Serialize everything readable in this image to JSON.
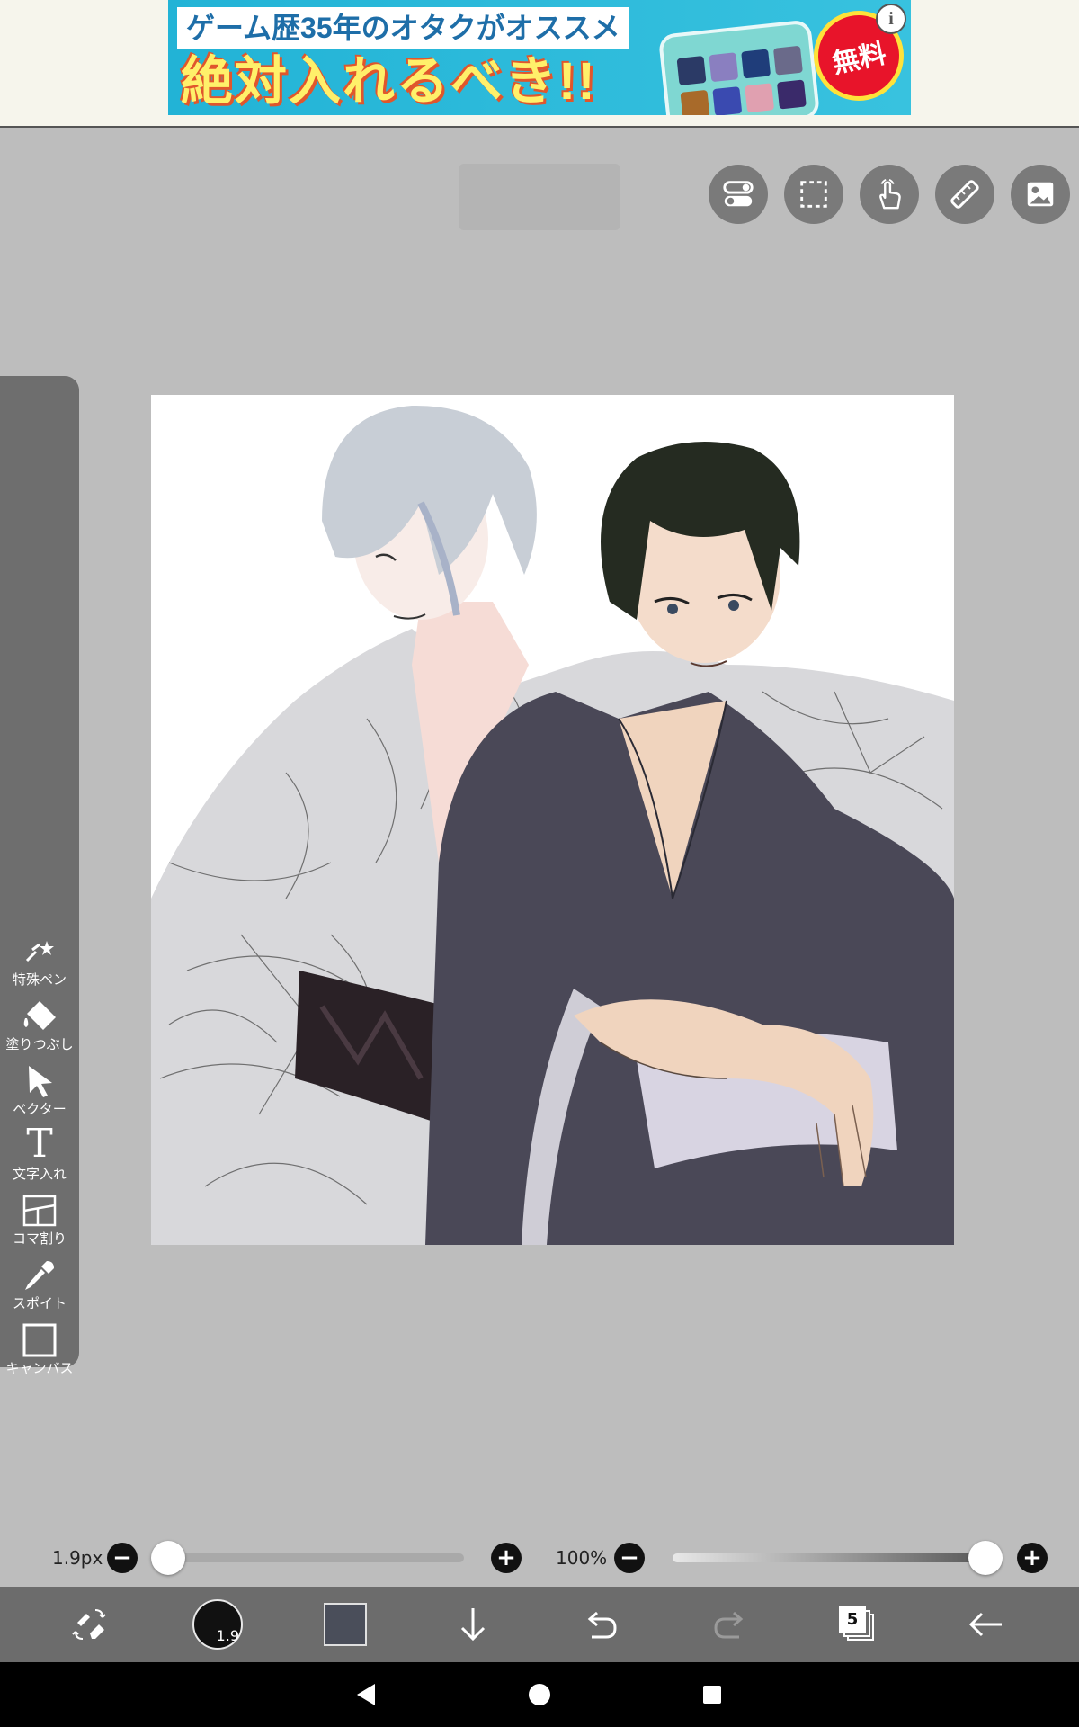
{
  "ad": {
    "line1": "ゲーム歴35年のオタクがオススメ",
    "line2": "絶対入れるべき!!",
    "badge": "無料",
    "info_icon": "info-icon"
  },
  "top_toolbar": {
    "buttons": [
      {
        "name": "toggle-icon"
      },
      {
        "name": "selection-icon"
      },
      {
        "name": "hand-icon"
      },
      {
        "name": "ruler-icon"
      },
      {
        "name": "image-icon"
      }
    ]
  },
  "left_toolbar": {
    "tools": [
      {
        "label": "特殊ペン",
        "icon": "special-pen-icon"
      },
      {
        "label": "塗りつぶし",
        "icon": "fill-icon"
      },
      {
        "label": "ベクター",
        "icon": "vector-icon"
      },
      {
        "label": "文字入れ",
        "icon": "text-icon",
        "glyph": "T"
      },
      {
        "label": "コマ割り",
        "icon": "panel-icon"
      },
      {
        "label": "スポイト",
        "icon": "eyedropper-icon"
      },
      {
        "label": "キャンバス",
        "icon": "canvas-icon"
      }
    ]
  },
  "brush": {
    "size_label": "1.9px",
    "size_fraction": 0.02,
    "opacity_label": "100%",
    "opacity_fraction": 1.0
  },
  "bottom_toolbar": {
    "brush_size_badge": "1.9",
    "layer_count": "5",
    "current_color": "#4a4e5a"
  },
  "colors": {
    "workspace": "#bdbdbd",
    "toolbar": "#6c6c6c",
    "canvas": "#ffffff"
  }
}
